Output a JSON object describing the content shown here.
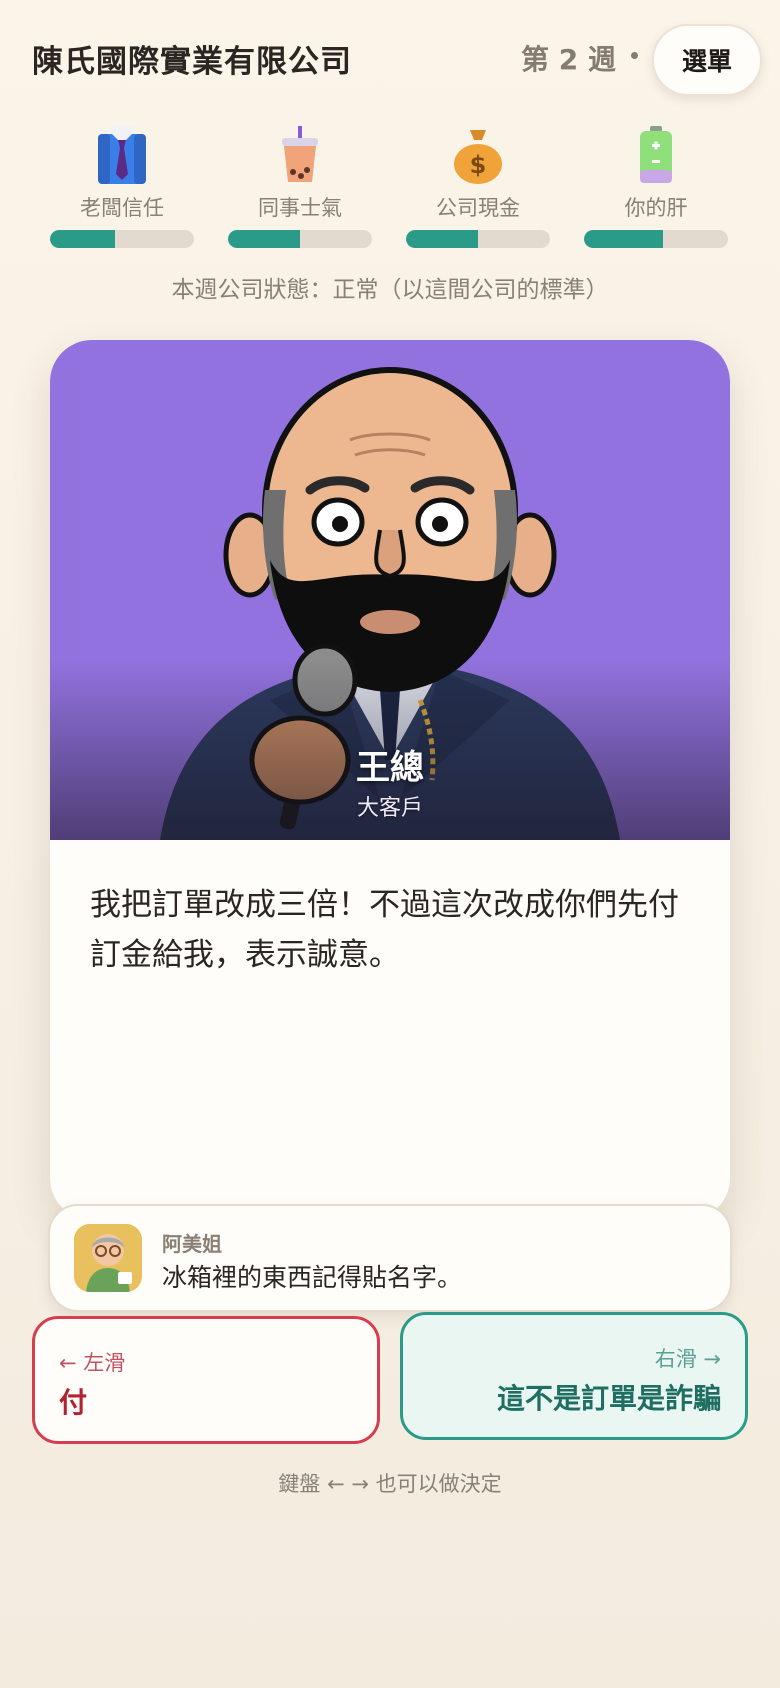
{
  "header": {
    "company_name": "陳氏國際實業有限公司",
    "week": "第 2 週",
    "menu_label": "選單"
  },
  "stats": [
    {
      "label": "老闆信任",
      "icon": "suit-tie-icon",
      "level": 0.45
    },
    {
      "label": "同事士氣",
      "icon": "bubble-tea-icon",
      "level": 0.5
    },
    {
      "label": "公司現金",
      "icon": "money-bag-icon",
      "level": 0.5
    },
    {
      "label": "你的肝",
      "icon": "battery-icon",
      "level": 0.55
    }
  ],
  "status_text": "本週公司狀態：正常（以這間公司的標準）",
  "card": {
    "character_name": "王總",
    "character_role": "大客戶",
    "dialogue": "我把訂單改成三倍！不過這次改成你們先付訂金給我，表示誠意。"
  },
  "tip": {
    "name": "阿美姐",
    "text": "冰箱裡的東西記得貼名字。"
  },
  "choices": {
    "left_hint": "← 左滑",
    "left_label": "付",
    "right_hint": "右滑 →",
    "right_label": "這不是訂單是詐騙"
  },
  "footer_hint": "鍵盤 ← → 也可以做決定",
  "colors": {
    "accent_green": "#2a9b89",
    "danger_red": "#d43e4e",
    "portrait_bg": "#9272de",
    "page_bg": "#f7efe4"
  }
}
